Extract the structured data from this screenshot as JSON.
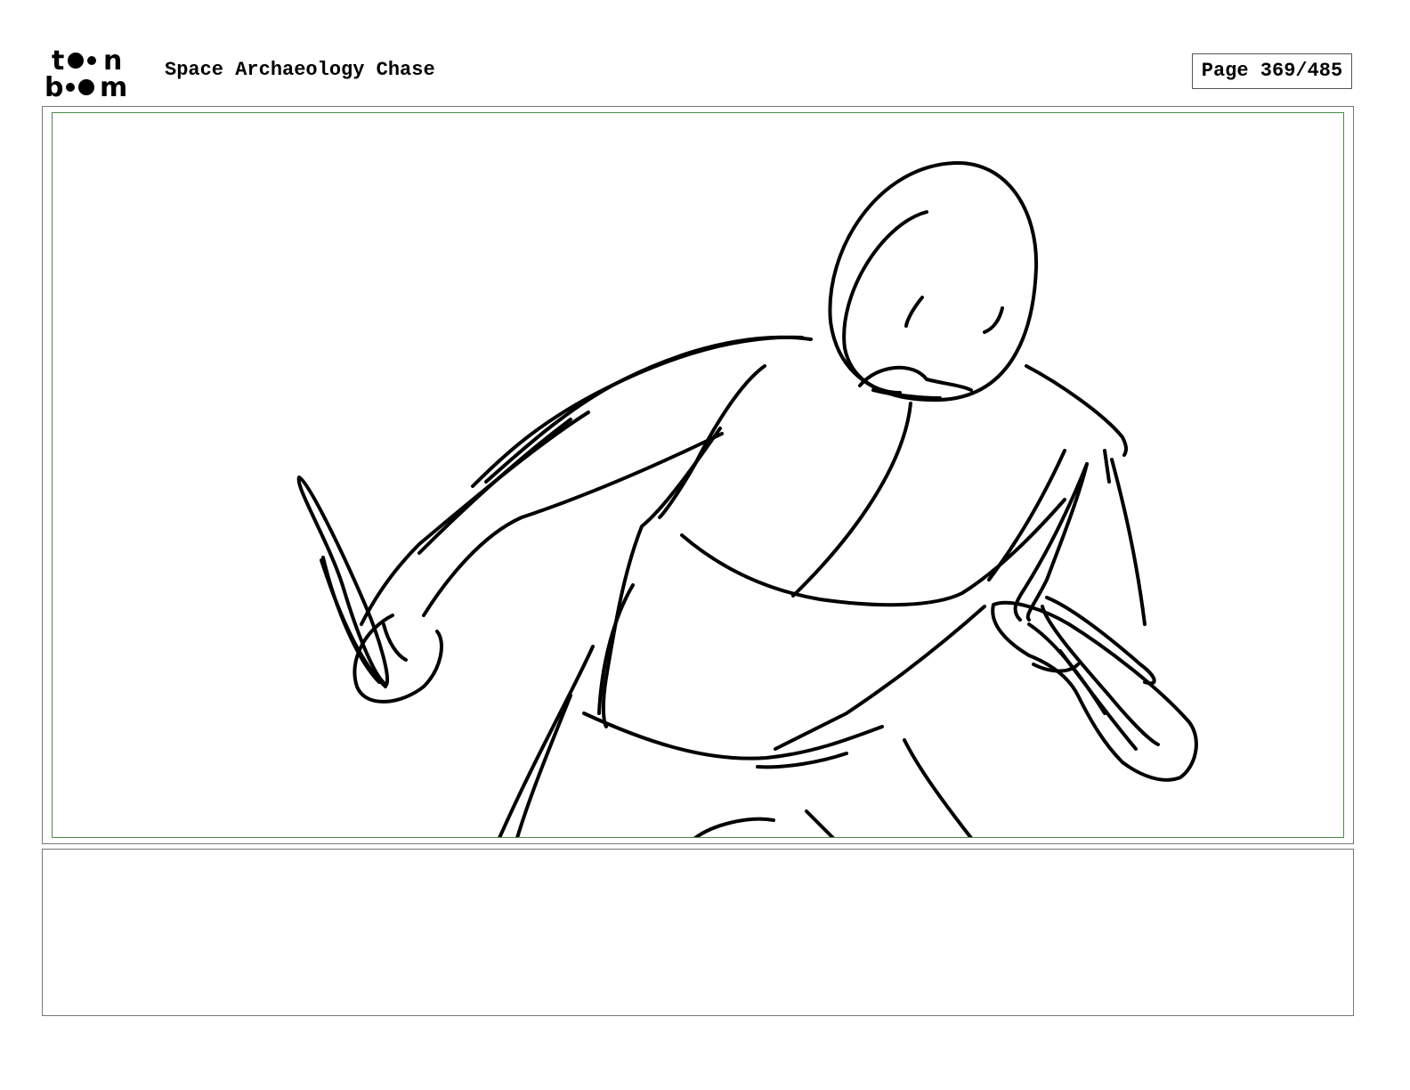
{
  "header": {
    "logo_text": "toon boom",
    "project_title": "Space Archaeology Chase",
    "page_label": "Page 369/485"
  },
  "panel": {
    "drawing": "rough-sketch-figure-holding-two-objects"
  },
  "notes": {
    "text": ""
  },
  "colors": {
    "frame_border": "#777777",
    "safe_area_border": "#4a8a4a",
    "ink": "#000000"
  }
}
